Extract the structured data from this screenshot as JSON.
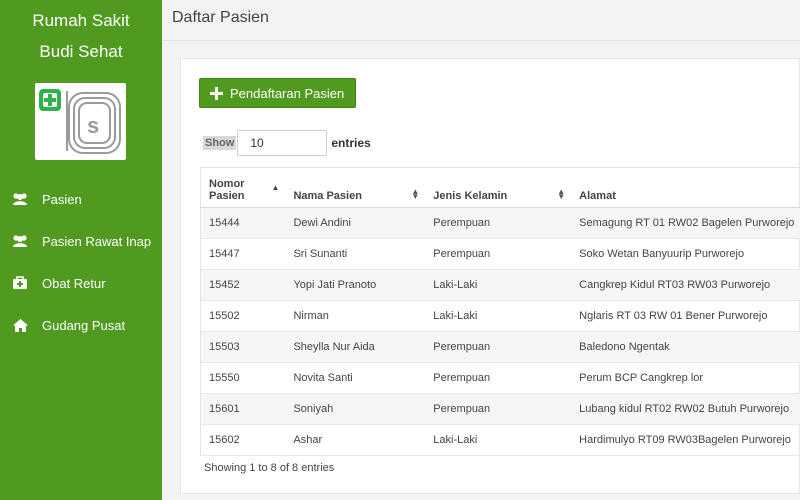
{
  "sidebar": {
    "brand_line1": "Rumah Sakit",
    "brand_line2": "Budi Sehat",
    "items": [
      {
        "label": "Pasien",
        "icon": "users-icon"
      },
      {
        "label": "Pasien Rawat Inap",
        "icon": "users-icon"
      },
      {
        "label": "Obat Retur",
        "icon": "medkit-icon"
      },
      {
        "label": "Gudang Pusat",
        "icon": "home-icon"
      }
    ]
  },
  "header": {
    "title": "Daftar Pasien"
  },
  "main": {
    "add_button_label": "Pendaftaran Pasien",
    "show_label": "Show",
    "entries_value": "10",
    "entries_suffix": "entries",
    "columns": [
      "Nomor Pasien",
      "Nama Pasien",
      "Jenis Kelamin",
      "Alamat"
    ],
    "column_nomor_line1": "Nomor",
    "column_nomor_line2": "Pasien",
    "rows": [
      {
        "nomor": "15444",
        "nama": "Dewi Andini",
        "jk": "Perempuan",
        "alamat": "Semagung RT 01 RW02 Bagelen Purworejo"
      },
      {
        "nomor": "15447",
        "nama": "Sri Sunanti",
        "jk": "Perempuan",
        "alamat": "Soko Wetan Banyuurip Purworejo"
      },
      {
        "nomor": "15452",
        "nama": "Yopi Jati Pranoto",
        "jk": "Laki-Laki",
        "alamat": "Cangkrep Kidul RT03 RW03 Purworejo"
      },
      {
        "nomor": "15502",
        "nama": "Nirman",
        "jk": "Laki-Laki",
        "alamat": "Nglaris RT 03 RW 01 Bener Purworejo"
      },
      {
        "nomor": "15503",
        "nama": "Sheylla Nur Aida",
        "jk": "Perempuan",
        "alamat": "Baledono Ngentak"
      },
      {
        "nomor": "15550",
        "nama": "Novita Santi",
        "jk": "Perempuan",
        "alamat": "Perum BCP Cangkrep lor"
      },
      {
        "nomor": "15601",
        "nama": "Soniyah",
        "jk": "Perempuan",
        "alamat": "Lubang kidul RT02 RW02 Butuh Purworejo"
      },
      {
        "nomor": "15602",
        "nama": "Ashar",
        "jk": "Laki-Laki",
        "alamat": "Hardimulyo RT09 RW03Bagelen Purworejo"
      }
    ],
    "info_text": "Showing 1 to 8 of 8 entries"
  },
  "colors": {
    "accent": "#4f9a1f",
    "background": "#f3f3f3"
  }
}
